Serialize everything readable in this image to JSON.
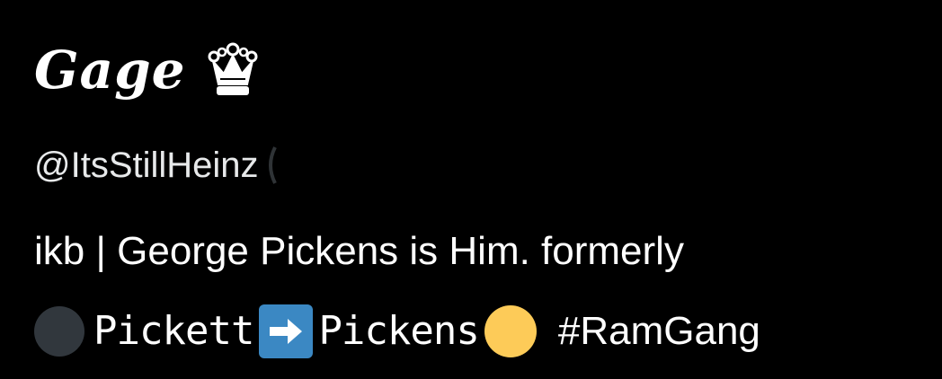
{
  "profile": {
    "display_name": "Gage",
    "crown_icon": "crown-icon",
    "handle": "@ItsStillHeinz"
  },
  "bio": {
    "line1": "ikb | George Pickens is Him. formerly",
    "word_from": "Pickett",
    "word_to": "Pickens",
    "hashtag": "#RamGang",
    "icons": [
      "black-circle-icon",
      "right-arrow-icon",
      "yellow-circle-icon"
    ]
  },
  "colors": {
    "background": "#000000",
    "text": "#ffffff",
    "handle_text": "#e7e9ea",
    "dark_circle": "#31373d",
    "arrow_box": "#3b88c3",
    "yellow_circle": "#fdcb58"
  }
}
